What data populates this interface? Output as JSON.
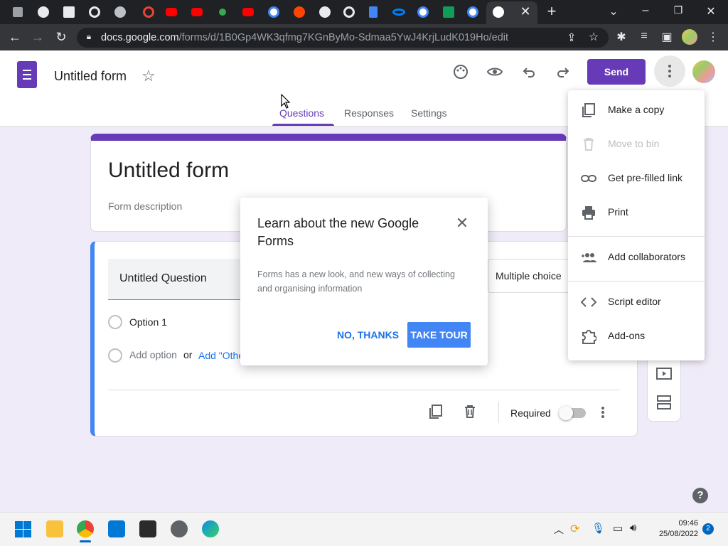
{
  "browser": {
    "url_host": "docs.google.com",
    "url_path": "/forms/d/1B0Gp4WK3qfmg7KGnByMo-Sdmaa5YwJ4KrjLudK019Ho/edit",
    "tab_icons": [
      "page-icon",
      "globe-icon",
      "calendar-icon",
      "chrome-icon",
      "globe-icon",
      "record-icon",
      "youtube-icon",
      "youtube-icon",
      "maps-icon",
      "youtube-icon",
      "google-icon",
      "reddit-icon",
      "globe-icon",
      "chrome-icon",
      "docs-icon",
      "meta-icon",
      "google-icon",
      "sheets-icon",
      "google-icon",
      "chrome-icon"
    ]
  },
  "header": {
    "doc_title": "Untitled form",
    "send_label": "Send",
    "tabs": [
      {
        "label": "Questions",
        "active": true
      },
      {
        "label": "Responses",
        "active": false
      },
      {
        "label": "Settings",
        "active": false
      }
    ]
  },
  "form": {
    "title": "Untitled form",
    "description_placeholder": "Form description"
  },
  "question": {
    "title": "Untitled Question",
    "type": "Multiple choice",
    "option1": "Option 1",
    "add_option": "Add option",
    "or": "or",
    "add_other": "Add \"Other\"",
    "required_label": "Required",
    "required": false
  },
  "popup": {
    "title": "Learn about the new Google Forms",
    "body": "Forms has a new look, and new ways of collecting and organising information",
    "no_thanks": "NO, THANKS",
    "take_tour": "TAKE TOUR"
  },
  "menu": {
    "items": [
      {
        "label": "Make a copy",
        "icon": "copy-icon",
        "disabled": false
      },
      {
        "label": "Move to bin",
        "icon": "trash-icon",
        "disabled": true
      },
      {
        "label": "Get pre-filled link",
        "icon": "link-icon",
        "disabled": false
      },
      {
        "label": "Print",
        "icon": "print-icon",
        "disabled": false
      },
      {
        "label": "Add collaborators",
        "icon": "add-people-icon",
        "disabled": false
      },
      {
        "label": "Script editor",
        "icon": "code-icon",
        "disabled": false
      },
      {
        "label": "Add-ons",
        "icon": "puzzle-icon",
        "disabled": false
      }
    ]
  },
  "taskbar": {
    "time": "09:46",
    "date": "25/08/2022",
    "notifications": "2"
  },
  "colors": {
    "brand": "#673ab7",
    "background": "#f0ebf8",
    "accent_blue": "#4285f4"
  }
}
